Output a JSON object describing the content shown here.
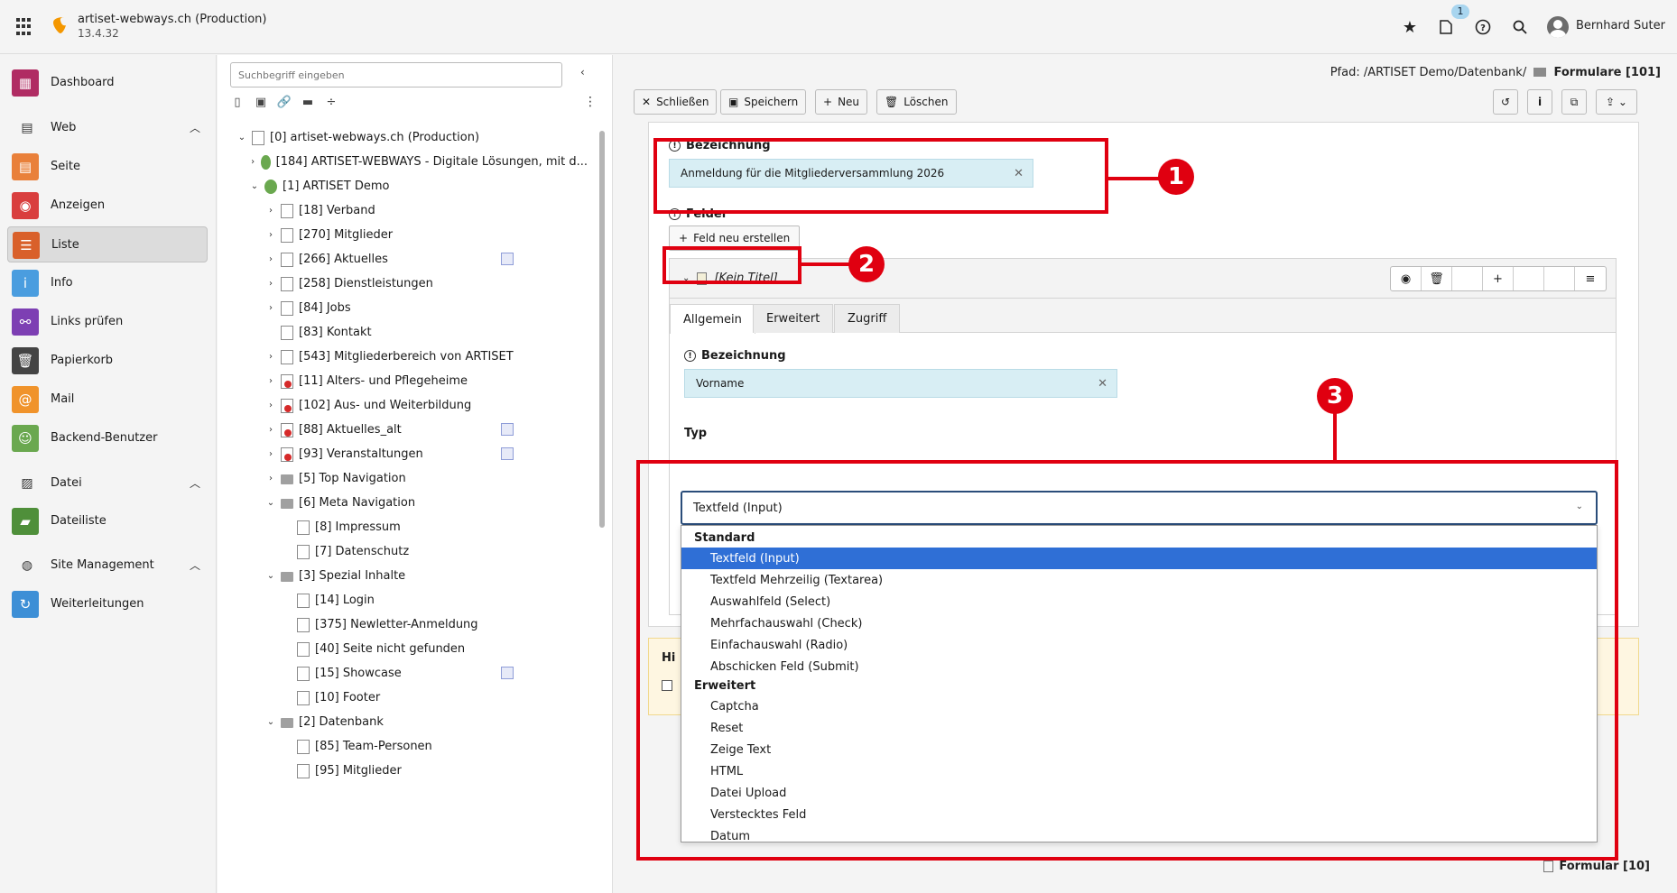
{
  "topbar": {
    "site_title": "artiset-webways.ch (Production)",
    "version": "13.4.32",
    "notification_count": "1",
    "user_name": "Bernhard Suter"
  },
  "modules": [
    {
      "label": "Dashboard",
      "icon": "dashboard-icon",
      "color": "#b02c63"
    },
    {
      "label": "Web",
      "icon": "page-icon",
      "group": true
    },
    {
      "label": "Seite",
      "icon": "page-icon",
      "color": "#e9803a"
    },
    {
      "label": "Anzeigen",
      "icon": "eye-icon",
      "color": "#d93e3e"
    },
    {
      "label": "Liste",
      "icon": "list-icon",
      "color": "#d9602a"
    },
    {
      "label": "Info",
      "icon": "info-icon",
      "color": "#4a9ddf"
    },
    {
      "label": "Links prüfen",
      "icon": "link-icon",
      "color": "#7d3fb3"
    },
    {
      "label": "Papierkorb",
      "icon": "trash-icon",
      "color": "#444444"
    },
    {
      "label": "Mail",
      "icon": "mail-icon",
      "color": "#f0932b"
    },
    {
      "label": "Backend-Benutzer",
      "icon": "users-icon",
      "color": "#6aa84f"
    },
    {
      "label": "Datei",
      "icon": "image-icon",
      "group": true
    },
    {
      "label": "Dateiliste",
      "icon": "folder-icon",
      "color": "#4f8f3a"
    },
    {
      "label": "Site Management",
      "icon": "globe-icon",
      "group": true
    },
    {
      "label": "Weiterleitungen",
      "icon": "redirect-icon",
      "color": "#3d8fd6"
    }
  ],
  "tree": {
    "search_placeholder": "Suchbegriff eingeben",
    "nodes": [
      {
        "label": "[0] artiset-webways.ch (Production)",
        "level": 0
      },
      {
        "label": "[184] ARTISET-WEBWAYS - Digitale Lösungen, mit d...",
        "level": 1
      },
      {
        "label": "[1] ARTISET Demo",
        "level": 1
      },
      {
        "label": "[18] Verband",
        "level": 2
      },
      {
        "label": "[270] Mitglieder",
        "level": 2
      },
      {
        "label": "[266] Aktuelles",
        "level": 2
      },
      {
        "label": "[258] Dienstleistungen",
        "level": 2
      },
      {
        "label": "[84] Jobs",
        "level": 2
      },
      {
        "label": "[83] Kontakt",
        "level": 2
      },
      {
        "label": "[543] Mitgliederbereich von ARTISET",
        "level": 2
      },
      {
        "label": "[11] Alters- und Pflegeheime",
        "level": 2
      },
      {
        "label": "[102] Aus- und Weiterbildung",
        "level": 2
      },
      {
        "label": "[88] Aktuelles_alt",
        "level": 2
      },
      {
        "label": "[93] Veranstaltungen",
        "level": 2
      },
      {
        "label": "[5] Top Navigation",
        "level": 2
      },
      {
        "label": "[6] Meta Navigation",
        "level": 2
      },
      {
        "label": "[8] Impressum",
        "level": 3
      },
      {
        "label": "[7] Datenschutz",
        "level": 3
      },
      {
        "label": "[3] Spezial Inhalte",
        "level": 2
      },
      {
        "label": "[14] Login",
        "level": 3
      },
      {
        "label": "[375] Newletter-Anmeldung",
        "level": 3
      },
      {
        "label": "[40] Seite nicht gefunden",
        "level": 3
      },
      {
        "label": "[15] Showcase",
        "level": 3
      },
      {
        "label": "[10] Footer",
        "level": 3
      },
      {
        "label": "[2] Datenbank",
        "level": 2
      },
      {
        "label": "[85] Team-Personen",
        "level": 3
      },
      {
        "label": "[95] Mitglieder",
        "level": 3
      }
    ]
  },
  "path": {
    "prefix": "Pfad: /ARTISET Demo/Datenbank/",
    "current": "Formulare [101]"
  },
  "toolbar": {
    "close": "Schließen",
    "save": "Speichern",
    "new": "Neu",
    "delete": "Löschen"
  },
  "form": {
    "name_label": "Bezeichnung",
    "name_value": "Anmeldung für die Mitgliederversammlung 2026",
    "fields_label": "Felder",
    "new_field_button": "Feld neu erstellen",
    "inline_title": "[Kein Titel]",
    "tabs": [
      "Allgemein",
      "Erweitert",
      "Zugriff"
    ],
    "field_name_label": "Bezeichnung",
    "field_name_value": "Vorname",
    "type_label": "Typ",
    "type_value": "Textfeld (Input)",
    "hint_title": "Hi",
    "bottom_ref": "Formular [10]"
  },
  "dropdown": {
    "groups": [
      {
        "label": "Standard",
        "options": [
          "Textfeld (Input)",
          "Textfeld Mehrzeilig (Textarea)",
          "Auswahlfeld (Select)",
          "Mehrfachauswahl (Check)",
          "Einfachauswahl (Radio)",
          "Abschicken Feld (Submit)"
        ]
      },
      {
        "label": "Erweitert",
        "options": [
          "Captcha",
          "Reset",
          "Zeige Text",
          "HTML",
          "Datei Upload",
          "Verstecktes Feld",
          "Datum"
        ]
      }
    ],
    "selected": "Textfeld (Input)"
  },
  "annotations": [
    "1",
    "2",
    "3"
  ],
  "colors": {
    "annotation": "#e00010",
    "selected": "#2f6fd6",
    "field_bg": "#d8eef4",
    "hint_bg": "#fef6e1"
  }
}
